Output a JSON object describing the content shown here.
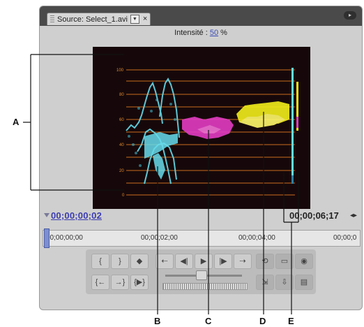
{
  "tab": {
    "title": "Source: Select_1.avi",
    "menu_glyph": "▼",
    "close_glyph": "×"
  },
  "panel_menu_icon": "panel-menu-icon",
  "intensity": {
    "label": "Intensité :",
    "value": "50",
    "unit": "%"
  },
  "scope": {
    "scale_labels": [
      "100",
      "80",
      "60",
      "40",
      "20",
      "0"
    ],
    "colors": {
      "background": "#16080a",
      "graticule": "#c96d1f",
      "cyan": "#66dcec",
      "magenta": "#e33cc3",
      "yellow": "#f2ee1a"
    }
  },
  "timecode": {
    "current": "00;00;00;02",
    "duration": "00;00;06;17"
  },
  "ruler": {
    "labels": [
      "00;00;00;00",
      "00;00;02;00",
      "00;00;04;00",
      "00;00;0"
    ]
  },
  "controls": {
    "buttons": [
      {
        "name": "mark-in-button",
        "glyph": "{"
      },
      {
        "name": "mark-out-button",
        "glyph": "}"
      },
      {
        "name": "set-marker-button",
        "glyph": "◆"
      },
      {
        "name": "goto-in-button",
        "glyph": "{←"
      },
      {
        "name": "goto-out-button",
        "glyph": "→}"
      },
      {
        "name": "play-in-to-out-button",
        "glyph": "{▶}"
      },
      {
        "name": "shuttle-left-button",
        "glyph": "⇠"
      },
      {
        "name": "step-back-button",
        "glyph": "◀|"
      },
      {
        "name": "play-button",
        "glyph": "▶"
      },
      {
        "name": "step-forward-button",
        "glyph": "|▶"
      },
      {
        "name": "shuttle-right-button",
        "glyph": "⇢"
      },
      {
        "name": "loop-button",
        "glyph": "⟲"
      },
      {
        "name": "safe-margins-button",
        "glyph": "▭"
      },
      {
        "name": "output-button",
        "glyph": "◉"
      },
      {
        "name": "insert-button",
        "glyph": "⇲"
      },
      {
        "name": "overlay-button",
        "glyph": "⇩"
      },
      {
        "name": "export-frame-button",
        "glyph": "▤"
      }
    ]
  },
  "callouts": [
    "A",
    "B",
    "C",
    "D",
    "E"
  ]
}
